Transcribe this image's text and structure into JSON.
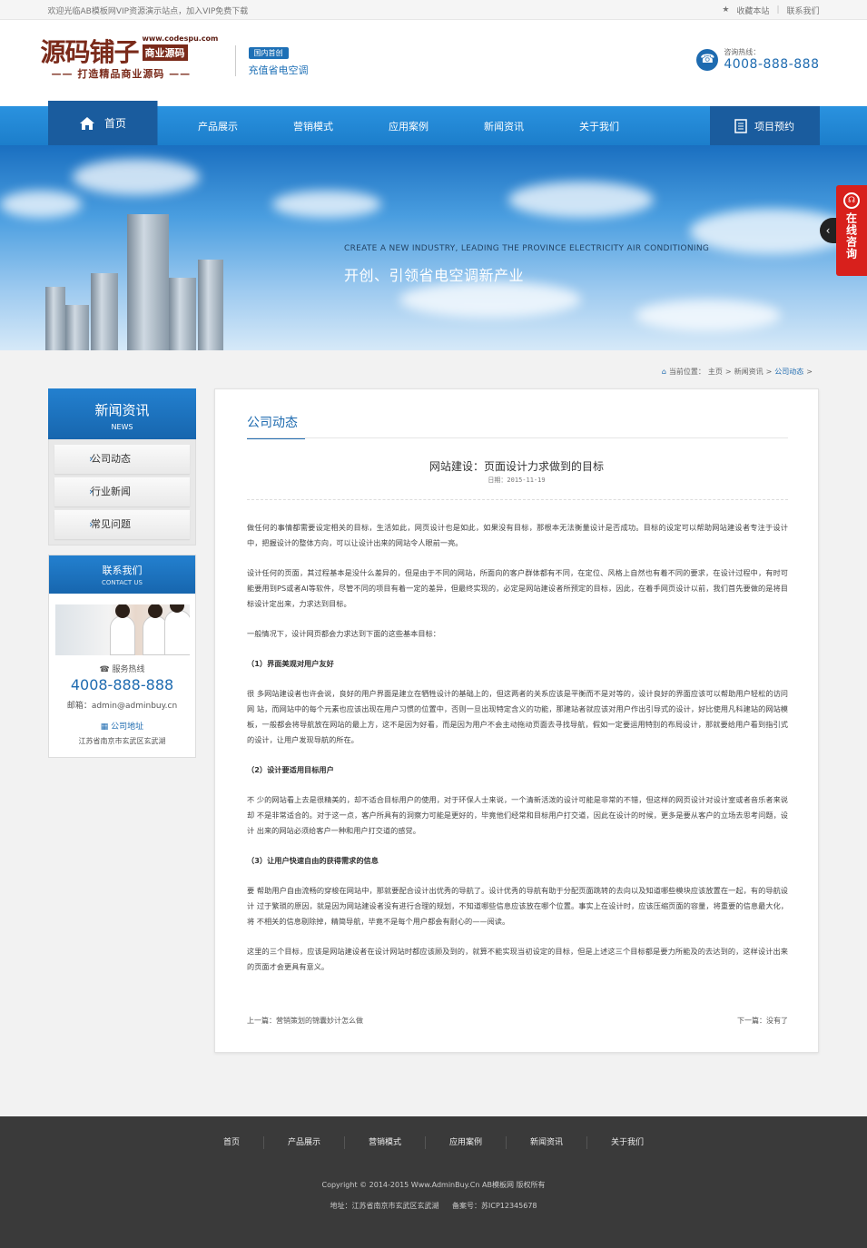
{
  "topbar": {
    "welcome": "欢迎光临AB模板网VIP资源演示站点，加入VIP免费下载",
    "favorite": "收藏本站",
    "contact": "联系我们"
  },
  "header": {
    "logo_main": "源码铺子",
    "logo_url": "www.codespu.com",
    "logo_tag": "商业源码",
    "logo_slogan": "—— 打造精品商业源码 ——",
    "badge": "国内首创",
    "subtitle": "充值省电空调",
    "hotline_label": "咨询热线：",
    "hotline_number": "4008-888-888"
  },
  "nav": {
    "home": "首页",
    "items": [
      "产品展示",
      "营销模式",
      "应用案例",
      "新闻资讯",
      "关于我们"
    ],
    "book": "项目预约"
  },
  "banner": {
    "en": "CREATE A NEW INDUSTRY, LEADING THE PROVINCE ELECTRICITY AIR CONDITIONING",
    "cn": "开创、引领省电空调新产业"
  },
  "consult": {
    "label": "在线咨询"
  },
  "breadcrumb": {
    "prefix": "当前位置：",
    "items": [
      "主页",
      "新闻资讯",
      "公司动态"
    ]
  },
  "sidebar": {
    "title": "新闻资讯",
    "title_en": "NEWS",
    "items": [
      "公司动态",
      "行业新闻",
      "常见问题"
    ],
    "contact_title": "联系我们",
    "contact_title_en": "CONTACT US",
    "hotline_label": "服务热线",
    "hotline": "4008-888-888",
    "email": "邮箱：admin@adminbuy.cn",
    "address_label": "公司地址",
    "address": "江苏省南京市玄武区玄武湖"
  },
  "article": {
    "section": "公司动态",
    "title": "网站建设：页面设计力求做到的目标",
    "date": "日期：2015-11-19",
    "paragraphs": [
      "做任何的事情都需要设定相关的目标，生活如此，网页设计也是如此，如果没有目标，那根本无法衡量设计是否成功。目标的设定可以帮助网站建设者专注于设计中，把握设计的整体方向，可以让设计出来的网站令人眼前一亮。",
      "设计任何的页面，其过程基本是没什么差异的，但是由于不同的网站，所面向的客户群体都有不同，在定位、风格上自然也有着不同的要求，在设计过程中，有时可能要用到PS或者AI等软件，尽管不同的项目有着一定的差异，但最终实现的，必定是网站建设者所预定的目标，因此，在着手网页设计以前，我们首先要做的是将目标设计定出来，力求达到目标。",
      "一般情况下，设计网页都会力求达到下面的这些基本目标：",
      "（1）界面美观对用户友好",
      "很 多网站建设者也许会说，良好的用户界面是建立在牺牲设计的基础上的，但这两者的关系应该是平衡而不是对等的，设计良好的界面应该可以帮助用户轻松的访问网 站，而网站中的每个元素也应该出现在用户习惯的位置中，否则一旦出现特定含义的功能，那建站者就应该对用户作出引导式的设计，好比使用凡科建站的网站模 板，一般都会将导航放在网站的最上方，这不是因为好看，而是因为用户不会主动拖动页面去寻找导航，假如一定要运用特别的布局设计，那就要给用户看到指引式 的设计，让用户发现导航的所在。",
      "（2）设计要适用目标用户",
      "不 少的网站看上去是很精美的，却不适合目标用户的使用，对于环保人士来说，一个清新活泼的设计可能是非常的不错，但这样的网页设计对设计室或者音乐者来说却 不是非常适合的。对于这一点，客户所具有的洞察力可能是更好的，毕竟他们经常和目标用户打交道，因此在设计的时候，更多是要从客户的立场去思考问题，设计 出来的网站必须给客户一种和用户打交道的感觉。",
      "（3）让用户快速自由的获得需求的信息",
      "要 帮助用户自由流畅的穿梭在网站中，那就要配合设计出优秀的导航了。设计优秀的导航有助于分配页面跳转的去向以及知道哪些模块应该放置在一起，有的导航设计 过于繁琐的原因，就是因为网站建设者没有进行合理的规划，不知道哪些信息应该放在哪个位置。事实上在设计时，应该压缩页面的容量，将重要的信息最大化，将 不相关的信息剔除掉，精简导航，毕竟不是每个用户都会有耐心的——阅读。",
      "这里的三个目标，应该是网站建设者在设计网站时都应该顾及到的，就算不能实现当初设定的目标，但是上述这三个目标都是要力所能及的去达到的，这样设计出来的页面才会更具有意义。"
    ],
    "prev": "上一篇：营销策划的锦囊妙计怎么做",
    "next": "下一篇：没有了"
  },
  "footer": {
    "nav": [
      "首页",
      "产品展示",
      "营销模式",
      "应用案例",
      "新闻资讯",
      "关于我们"
    ],
    "copyright": "Copyright © 2014-2015 Www.AdminBuy.Cn AB模板网 版权所有",
    "address": "地址：江苏省南京市玄武区玄武湖",
    "icp": "备案号：苏ICP12345678"
  },
  "colors": {
    "brand_blue": "#1e6bb0",
    "nav_blue": "#1f86d6",
    "nav_dark": "#1a5c9e",
    "consult_red": "#d8201c",
    "footer_bg": "#3a3a3a"
  }
}
